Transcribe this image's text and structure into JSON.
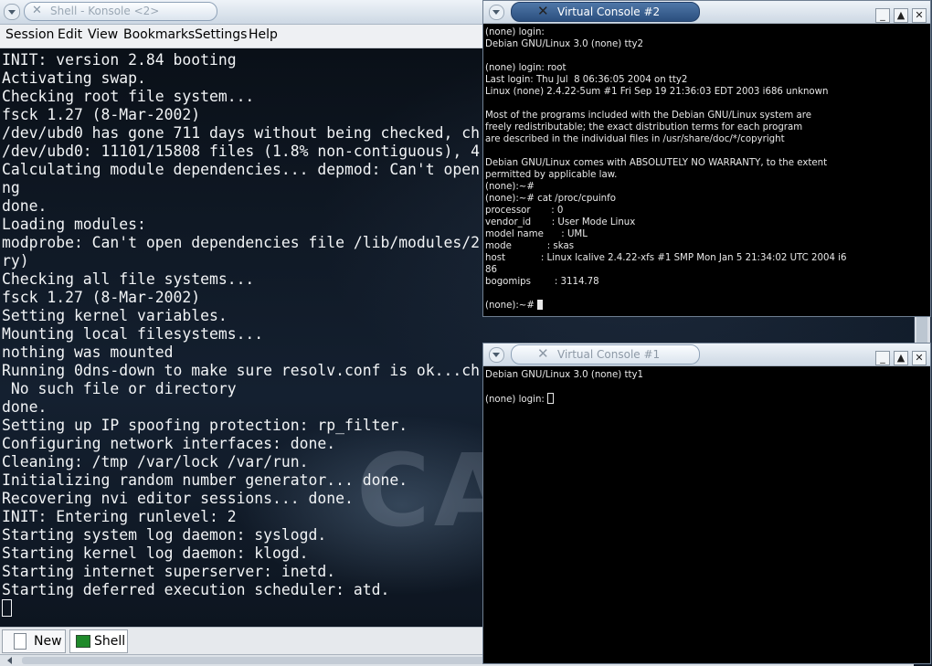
{
  "konsole": {
    "title": "Shell - Konsole <2>",
    "menu": [
      "Session",
      "Edit",
      "View",
      "Bookmarks",
      "Settings",
      "Help"
    ],
    "watermark": "CA",
    "lines": [
      "INIT: version 2.84 booting",
      "Activating swap.",
      "Checking root file system...",
      "fsck 1.27 (8-Mar-2002)",
      "/dev/ubd0 has gone 711 days without being checked, ch",
      "/dev/ubd0: 11101/15808 files (1.8% non-contiguous), 4",
      "Calculating module dependencies... depmod: Can't open",
      "ng",
      "done.",
      "Loading modules:",
      "modprobe: Can't open dependencies file /lib/modules/2",
      "ry)",
      "Checking all file systems...",
      "fsck 1.27 (8-Mar-2002)",
      "Setting kernel variables.",
      "Mounting local filesystems...",
      "nothing was mounted",
      "Running 0dns-down to make sure resolv.conf is ok...ch",
      " No such file or directory",
      "done.",
      "Setting up IP spoofing protection: rp_filter.",
      "Configuring network interfaces: done.",
      "Cleaning: /tmp /var/lock /var/run.",
      "Initializing random number generator... done.",
      "Recovering nvi editor sessions... done.",
      "INIT: Entering runlevel: 2",
      "Starting system log daemon: syslogd.",
      "Starting kernel log daemon: klogd.",
      "Starting internet superserver: inetd.",
      "Starting deferred execution scheduler: atd."
    ],
    "tabs": [
      {
        "label": "New"
      },
      {
        "label": "Shell"
      }
    ]
  },
  "vc2": {
    "title": "Virtual Console #2",
    "lines": [
      "(none) login:",
      "Debian GNU/Linux 3.0 (none) tty2",
      "",
      "(none) login: root",
      "Last login: Thu Jul  8 06:36:05 2004 on tty2",
      "Linux (none) 2.4.22-5um #1 Fri Sep 19 21:36:03 EDT 2003 i686 unknown",
      "",
      "Most of the programs included with the Debian GNU/Linux system are",
      "freely redistributable; the exact distribution terms for each program",
      "are described in the individual files in /usr/share/doc/*/copyright",
      "",
      "Debian GNU/Linux comes with ABSOLUTELY NO WARRANTY, to the extent",
      "permitted by applicable law.",
      "(none):~#",
      "(none):~# cat /proc/cpuinfo",
      "processor       : 0",
      "vendor_id       : User Mode Linux",
      "model name      : UML",
      "mode            : skas",
      "host            : Linux lcalive 2.4.22-xfs #1 SMP Mon Jan 5 21:34:02 UTC 2004 i6",
      "86",
      "bogomips        : 3114.78",
      ""
    ],
    "prompt": "(none):~# "
  },
  "vc1": {
    "title": "Virtual Console #1",
    "lines": [
      "Debian GNU/Linux 3.0 (none) tty1",
      ""
    ],
    "prompt": "(none) login: "
  }
}
